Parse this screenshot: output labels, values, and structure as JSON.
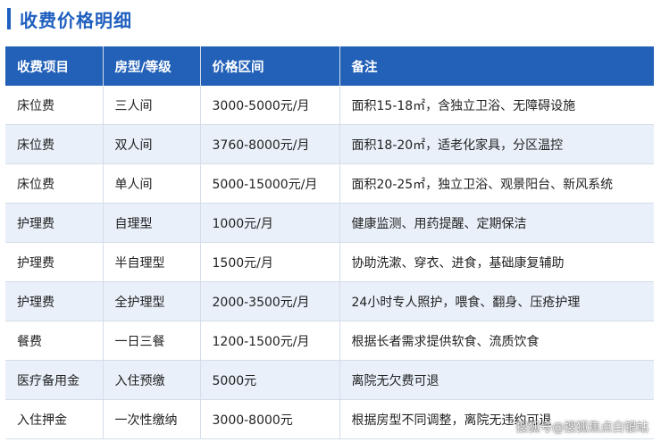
{
  "heading": "收费价格明细",
  "table": {
    "headers": [
      "收费项目",
      "房型/等级",
      "价格区间",
      "备注"
    ],
    "rows": [
      [
        "床位费",
        "三人间",
        "3000-5000元/月",
        "面积15-18㎡，含独立卫浴、无障碍设施"
      ],
      [
        "床位费",
        "双人间",
        "3760-8000元/月",
        "面积18-20㎡，适老化家具，分区温控"
      ],
      [
        "床位费",
        "单人间",
        "5000-15000元/月",
        "面积20-25㎡，独立卫浴、观景阳台、新风系统"
      ],
      [
        "护理费",
        "自理型",
        "1000元/月",
        "健康监测、用药提醒、定期保洁"
      ],
      [
        "护理费",
        "半自理型",
        "1500元/月",
        "协助洗漱、穿衣、进食，基础康复辅助"
      ],
      [
        "护理费",
        "全护理型",
        "2000-3500元/月",
        "24小时专人照护，喂食、翻身、压疮护理"
      ],
      [
        "餐费",
        "一日三餐",
        "1200-1500元/月",
        "根据长者需求提供软食、流质饮食"
      ],
      [
        "医疗备用金",
        "入住预缴",
        "5000元",
        "离院无欠费可退"
      ],
      [
        "入住押金",
        "一次性缴纳",
        "3000-8000元",
        "根据房型不同调整，离院无违约可退"
      ]
    ]
  },
  "watermark": "搜狐号@搜狐焦点白银站",
  "colors": {
    "accent": "#2361b8",
    "heading": "#1f5fbf",
    "stripe": "#e9f0f9"
  }
}
